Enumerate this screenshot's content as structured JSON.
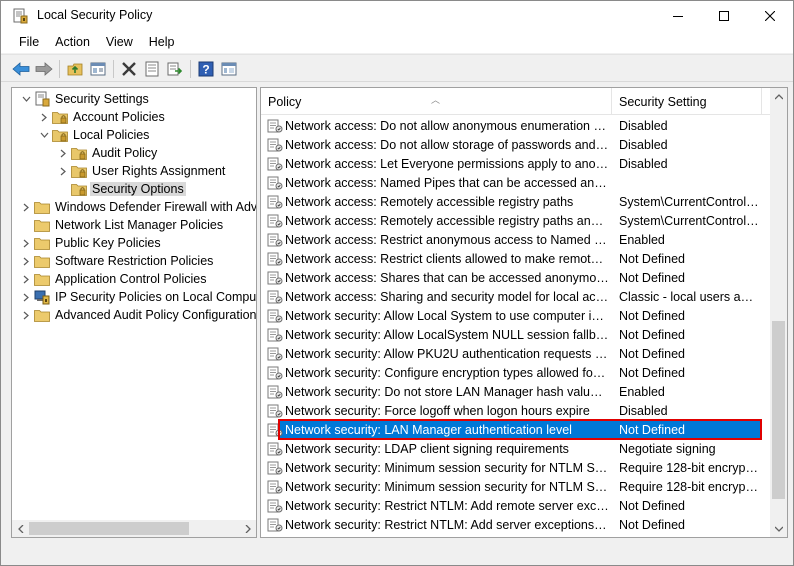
{
  "window": {
    "title": "Local Security Policy",
    "icon": "security-policy-icon"
  },
  "menu": [
    "File",
    "Action",
    "View",
    "Help"
  ],
  "toolbar": {
    "icons": [
      "back-arrow-icon",
      "forward-arrow-icon",
      "up-folder-icon",
      "show-hide-tree-icon",
      "delete-icon",
      "properties-icon",
      "export-list-icon",
      "help-icon",
      "view-icon"
    ]
  },
  "tree": {
    "items": [
      {
        "label": "Security Settings",
        "level": 0,
        "expander": "expanded",
        "icon": "security-settings-icon"
      },
      {
        "label": "Account Policies",
        "level": 1,
        "expander": "collapsed",
        "icon": "policy-folder-icon"
      },
      {
        "label": "Local Policies",
        "level": 1,
        "expander": "expanded",
        "icon": "policy-folder-icon"
      },
      {
        "label": "Audit Policy",
        "level": 2,
        "expander": "collapsed",
        "icon": "policy-folder-icon"
      },
      {
        "label": "User Rights Assignment",
        "level": 2,
        "expander": "collapsed",
        "icon": "policy-folder-icon"
      },
      {
        "label": "Security Options",
        "level": 2,
        "expander": "none",
        "icon": "policy-folder-icon",
        "selected": true
      },
      {
        "label": "Windows Defender Firewall with Adva",
        "level": 0,
        "expander": "collapsed",
        "icon": "folder-icon"
      },
      {
        "label": "Network List Manager Policies",
        "level": 0,
        "expander": "none",
        "icon": "folder-icon"
      },
      {
        "label": "Public Key Policies",
        "level": 0,
        "expander": "collapsed",
        "icon": "folder-icon"
      },
      {
        "label": "Software Restriction Policies",
        "level": 0,
        "expander": "collapsed",
        "icon": "folder-icon"
      },
      {
        "label": "Application Control Policies",
        "level": 0,
        "expander": "collapsed",
        "icon": "folder-icon"
      },
      {
        "label": "IP Security Policies on Local Compute",
        "level": 0,
        "expander": "collapsed",
        "icon": "ip-security-icon"
      },
      {
        "label": "Advanced Audit Policy Configuration",
        "level": 0,
        "expander": "collapsed",
        "icon": "folder-icon"
      }
    ]
  },
  "list": {
    "columns": {
      "policy": "Policy",
      "setting": "Security Setting"
    },
    "rows": [
      {
        "policy": "Network access: Do not allow anonymous enumeration of S...",
        "setting": "Disabled"
      },
      {
        "policy": "Network access: Do not allow storage of passwords and cre...",
        "setting": "Disabled"
      },
      {
        "policy": "Network access: Let Everyone permissions apply to anonym...",
        "setting": "Disabled"
      },
      {
        "policy": "Network access: Named Pipes that can be accessed anonym...",
        "setting": ""
      },
      {
        "policy": "Network access: Remotely accessible registry paths",
        "setting": "System\\CurrentControlS..."
      },
      {
        "policy": "Network access: Remotely accessible registry paths and sub...",
        "setting": "System\\CurrentControlS..."
      },
      {
        "policy": "Network access: Restrict anonymous access to Named Pipes...",
        "setting": "Enabled"
      },
      {
        "policy": "Network access: Restrict clients allowed to make remote call...",
        "setting": "Not Defined"
      },
      {
        "policy": "Network access: Shares that can be accessed anonymously",
        "setting": "Not Defined"
      },
      {
        "policy": "Network access: Sharing and security model for local accou...",
        "setting": "Classic - local users auth..."
      },
      {
        "policy": "Network security: Allow Local System to use computer ident...",
        "setting": "Not Defined"
      },
      {
        "policy": "Network security: Allow LocalSystem NULL session fallback",
        "setting": "Not Defined"
      },
      {
        "policy": "Network security: Allow PKU2U authentication requests to t...",
        "setting": "Not Defined"
      },
      {
        "policy": "Network security: Configure encryption types allowed for Ke...",
        "setting": "Not Defined"
      },
      {
        "policy": "Network security: Do not store LAN Manager hash value on ...",
        "setting": "Enabled"
      },
      {
        "policy": "Network security: Force logoff when logon hours expire",
        "setting": "Disabled"
      },
      {
        "policy": "Network security: LAN Manager authentication level",
        "setting": "Not Defined",
        "selected": true
      },
      {
        "policy": "Network security: LDAP client signing requirements",
        "setting": "Negotiate signing"
      },
      {
        "policy": "Network security: Minimum session security for NTLM SSP ...",
        "setting": "Require 128-bit encrypti..."
      },
      {
        "policy": "Network security: Minimum session security for NTLM SSP ...",
        "setting": "Require 128-bit encrypti..."
      },
      {
        "policy": "Network security: Restrict NTLM: Add remote server excepti...",
        "setting": "Not Defined"
      },
      {
        "policy": "Network security: Restrict NTLM: Add server exceptions in t...",
        "setting": "Not Defined"
      }
    ]
  },
  "colors": {
    "selection": "#0078d7",
    "highlight_border": "#e00000",
    "folder": "#dcb14a"
  }
}
